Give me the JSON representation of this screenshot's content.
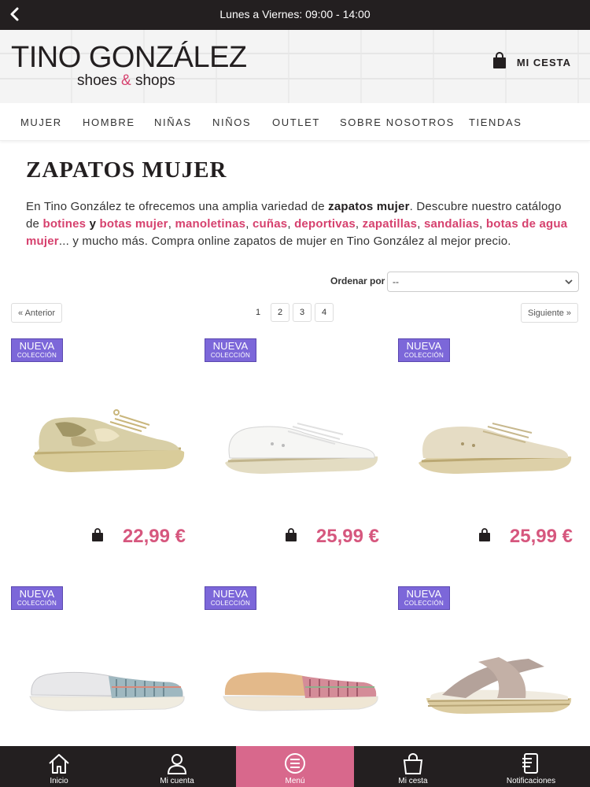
{
  "topbar": {
    "hours": "Lunes a Viernes: 09:00 - 14:00",
    "back_icon": "chevron-left-icon"
  },
  "header": {
    "logo_main": "TINO GONZÁLEZ",
    "logo_sub_left": "shoes ",
    "logo_sub_amp": "&",
    "logo_sub_right": " shops",
    "cart_label": "MI CESTA",
    "cart_icon": "shopping-bag-icon"
  },
  "nav": {
    "items": [
      "MUJER",
      "HOMBRE",
      "NIÑAS",
      "NIÑOS",
      "OUTLET",
      "SOBRE NOSOTROS",
      "TIENDAS"
    ]
  },
  "page": {
    "title": "ZAPATOS MUJER",
    "intro": {
      "t1": "En Tino González te ofrecemos una amplia variedad de ",
      "b1": "zapatos mujer",
      "t2": ". Descubre nuestro catálogo de ",
      "l1": "botines",
      "b2": " y ",
      "l2": "botas mujer",
      "c1": ", ",
      "l3": "manoletinas",
      "c2": ", ",
      "l4": "cuñas",
      "c3": ", ",
      "l5": "deportivas",
      "c4": ", ",
      "l6": "zapatillas",
      "c5": ", ",
      "l7": "sandalias",
      "c6": ", ",
      "l8": "botas de agua mujer",
      "t3": "... y mucho más. Compra online zapatos de mujer en Tino González al mejor precio."
    },
    "sort": {
      "label": "Ordenar por",
      "value": "--"
    },
    "pagination": {
      "prev": "« Anterior",
      "next": "Siguiente »",
      "pages": [
        "1",
        "2",
        "3",
        "4"
      ],
      "current": "1"
    }
  },
  "products": [
    {
      "badge_1": "NUEVA",
      "badge_2": "COLECCIÓN",
      "price": "22,99 €",
      "image": "sneaker-camo-espadrille"
    },
    {
      "badge_1": "NUEVA",
      "badge_2": "COLECCIÓN",
      "price": "25,99 €",
      "image": "sneaker-white-espadrille"
    },
    {
      "badge_1": "NUEVA",
      "badge_2": "COLECCIÓN",
      "price": "25,99 €",
      "image": "sneaker-beige-espadrille"
    },
    {
      "badge_1": "NUEVA",
      "badge_2": "COLECCIÓN",
      "price": "",
      "image": "slip-on-silver-ethnic"
    },
    {
      "badge_1": "NUEVA",
      "badge_2": "COLECCIÓN",
      "price": "",
      "image": "slip-on-gold-ethnic"
    },
    {
      "badge_1": "NUEVA",
      "badge_2": "COLECCIÓN",
      "price": "",
      "image": "sandal-crossed-metallic"
    }
  ],
  "tabbar": {
    "items": [
      {
        "label": "Inicio",
        "icon": "home-icon"
      },
      {
        "label": "Mi cuenta",
        "icon": "user-icon"
      },
      {
        "label": "Menú",
        "icon": "menu-icon"
      },
      {
        "label": "Mi cesta",
        "icon": "shopping-bag-icon"
      },
      {
        "label": "Notificaciones",
        "icon": "notifications-icon"
      }
    ],
    "active": "Menú"
  },
  "colors": {
    "dark": "#231f20",
    "accent_pink": "#d6416e",
    "price_pink": "#d6577e",
    "badge_purple": "#7c67d9",
    "tab_active": "#d8688c"
  }
}
